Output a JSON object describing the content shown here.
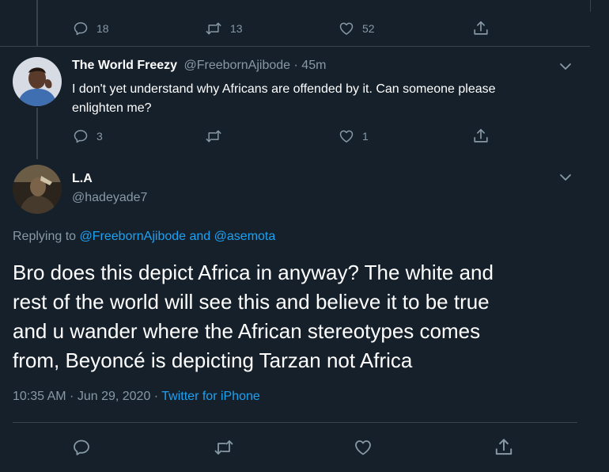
{
  "top_actions": {
    "reply": "18",
    "retweet": "13",
    "like": "52"
  },
  "reply_tweet": {
    "name": "The World Freezy",
    "handle": "@FreebornAjibode",
    "separator": "·",
    "time": "45m",
    "text_line1": "I don't yet understand why Africans are offended by it. Can someone please",
    "text_line2": "enlighten me?",
    "reply_count": "3",
    "like_count": "1"
  },
  "main_tweet": {
    "name": "L.A",
    "handle": "@hadeyade7",
    "replying_prefix": "Replying to",
    "replying_user1": "@FreebornAjibode",
    "replying_and": "and",
    "replying_user2": "@asemota",
    "body_lines": [
      "Bro does this depict Africa in anyway? The white and",
      "rest of the world will see this and believe it to be true",
      "and u wander where the African stereotypes comes",
      "from, Beyoncé is depicting Tarzan not Africa"
    ],
    "timestamp": "10:35 AM · Jun 29, 2020",
    "dot": "·",
    "source": "Twitter for iPhone"
  },
  "colors": {
    "background": "#15202b",
    "border": "#38444d",
    "muted": "#8899a6",
    "accent": "#1da1f2",
    "text": "#ffffff"
  },
  "icons": [
    "reply-icon",
    "retweet-icon",
    "like-icon",
    "share-icon",
    "chevron-down-icon"
  ]
}
